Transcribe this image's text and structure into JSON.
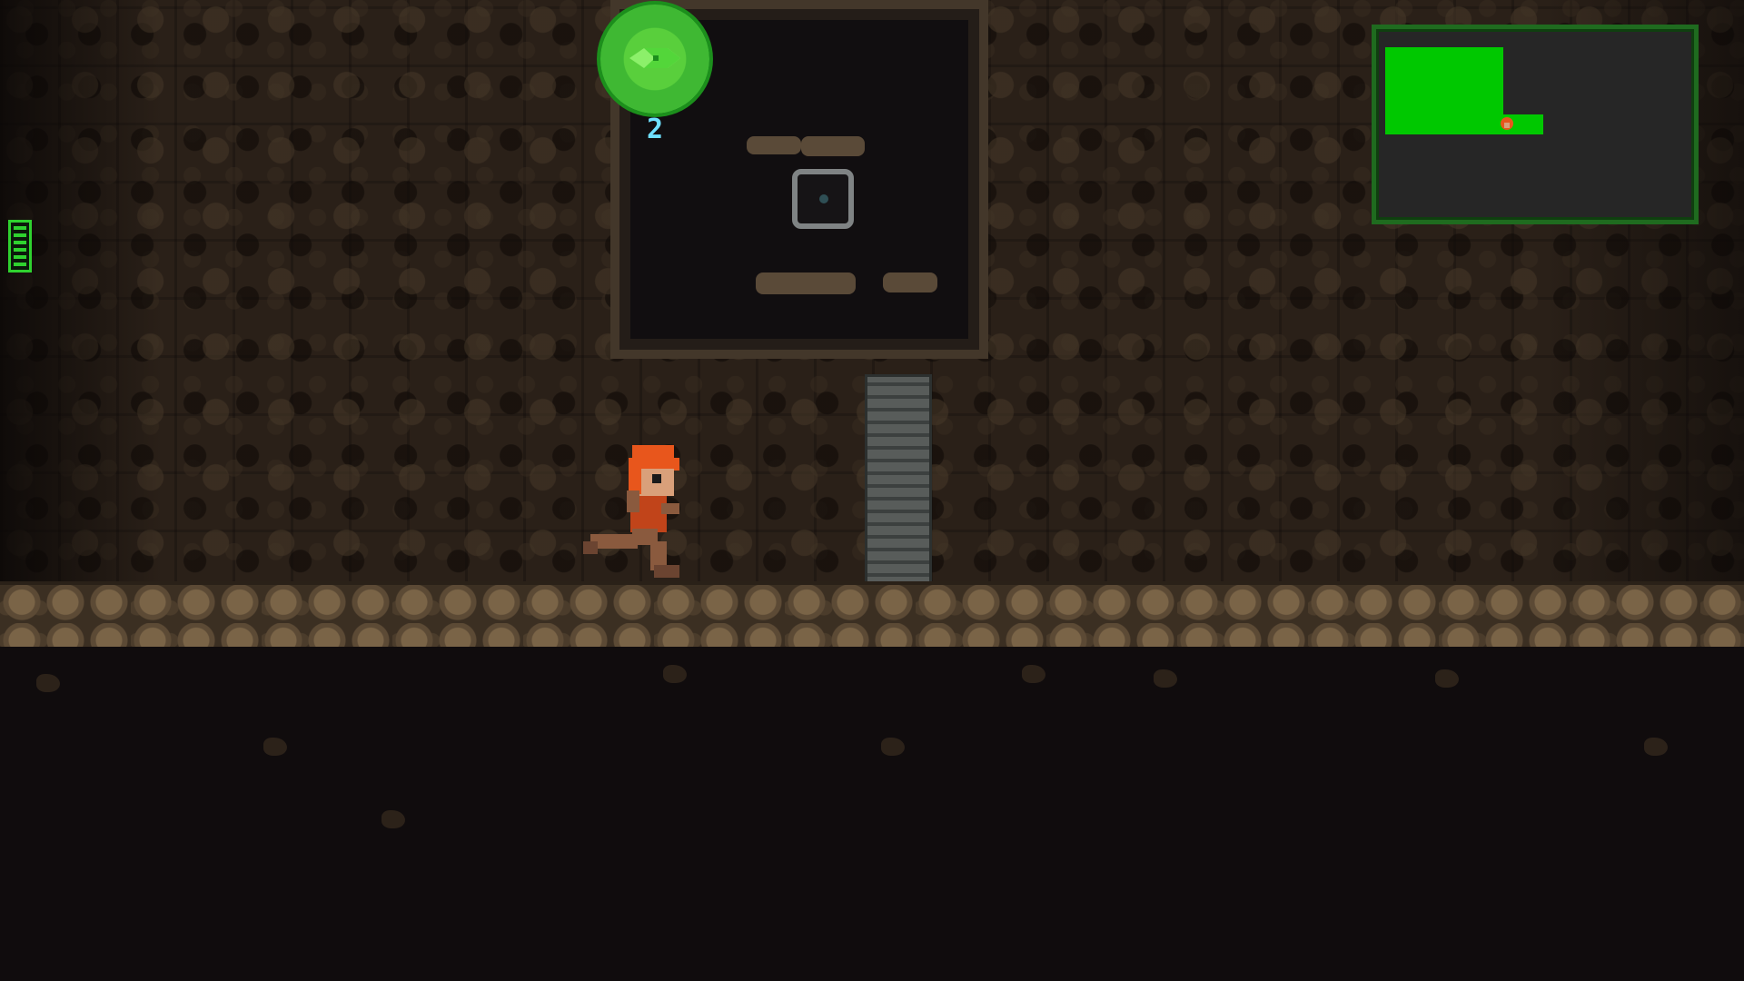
{
  "hud": {
    "collectible_count": "2",
    "health": {
      "segments": 6,
      "filled": 6
    },
    "minimap": {
      "rooms_explored": 2
    }
  },
  "colors": {
    "hud_green": "#2fd22f",
    "minimap_room": "#00c800",
    "count_text": "#6fe0ff",
    "player_hair": "#e8561c"
  },
  "icons": {
    "collectible": "green-gem-orb-icon",
    "save_point": "terminal-ring-icon",
    "player": "orange-haired-runner-sprite"
  }
}
